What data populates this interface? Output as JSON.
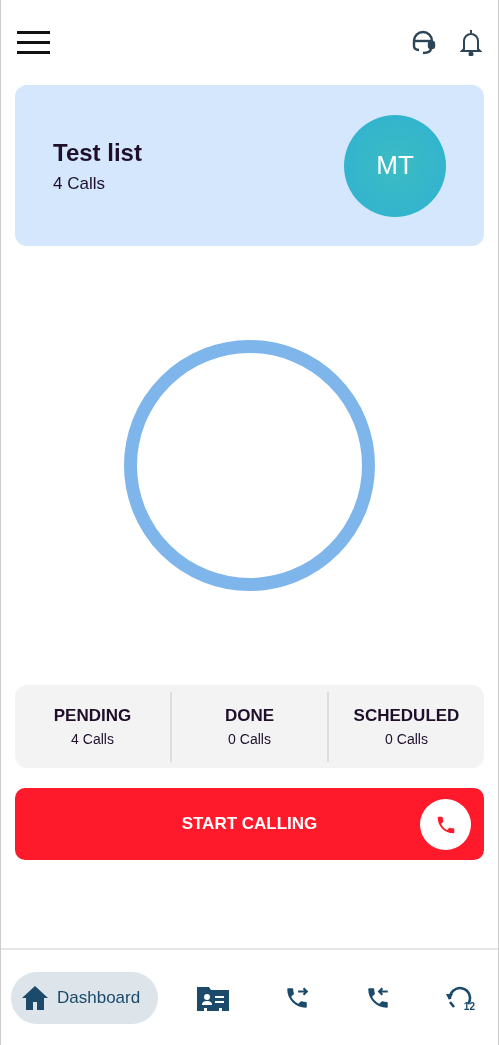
{
  "list_card": {
    "title": "Test list",
    "subtitle": "4 Calls",
    "avatar_initials": "MT"
  },
  "stats": [
    {
      "label": "PENDING",
      "value": "4 Calls"
    },
    {
      "label": "DONE",
      "value": "0 Calls"
    },
    {
      "label": "SCHEDULED",
      "value": "0 Calls"
    }
  ],
  "start_button": {
    "label": "START CALLING"
  },
  "bottom_nav": [
    {
      "label": "Dashboard",
      "selected": true
    },
    {
      "selected": false
    },
    {
      "selected": false
    },
    {
      "selected": false
    },
    {
      "selected": false,
      "badge": "12"
    }
  ]
}
